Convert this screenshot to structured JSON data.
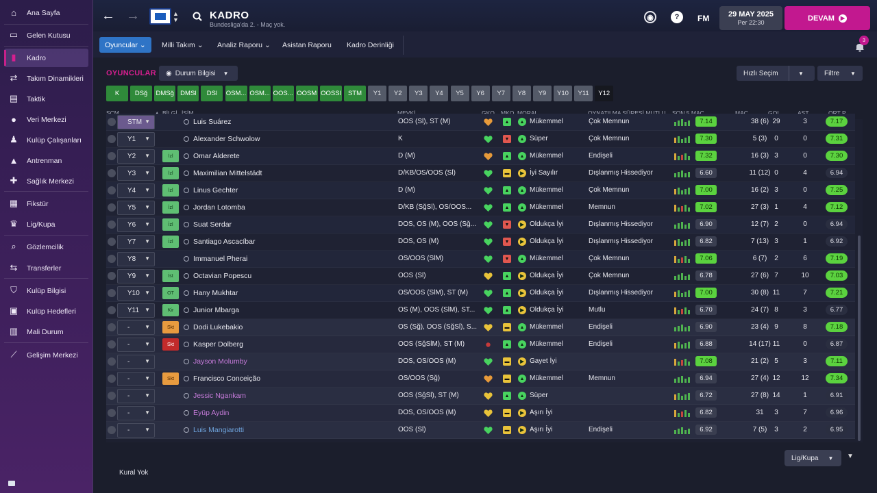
{
  "sidebar": [
    {
      "label": "Ana Sayfa",
      "icon": "home-icon",
      "glyph": "⌂"
    },
    {
      "label": "Gelen Kutusu",
      "icon": "inbox-icon",
      "glyph": "▭"
    },
    {
      "label": "Kadro",
      "icon": "shirt-icon",
      "glyph": "▮",
      "active": true
    },
    {
      "label": "Takım Dinamikleri",
      "icon": "team-dynamics-icon",
      "glyph": "⇄"
    },
    {
      "label": "Taktik",
      "icon": "tactics-icon",
      "glyph": "▤"
    },
    {
      "label": "Veri Merkezi",
      "icon": "data-hub-icon",
      "glyph": "●"
    },
    {
      "label": "Kulüp Çalışanları",
      "icon": "staff-icon",
      "glyph": "♟"
    },
    {
      "label": "Antrenman",
      "icon": "training-icon",
      "glyph": "▲"
    },
    {
      "label": "Sağlık Merkezi",
      "icon": "medical-icon",
      "glyph": "✚"
    },
    {
      "label": "Fikstür",
      "icon": "fixtures-icon",
      "glyph": "▦"
    },
    {
      "label": "Lig/Kupa",
      "icon": "trophy-icon",
      "glyph": "♛"
    },
    {
      "label": "Gözlemcilik",
      "icon": "scouting-icon",
      "glyph": "⌕"
    },
    {
      "label": "Transferler",
      "icon": "transfers-icon",
      "glyph": "⇆"
    },
    {
      "label": "Kulüp Bilgisi",
      "icon": "club-info-icon",
      "glyph": "⛉"
    },
    {
      "label": "Kulüp Hedefleri",
      "icon": "club-goals-icon",
      "glyph": "▣"
    },
    {
      "label": "Mali Durum",
      "icon": "finances-icon",
      "glyph": "▥"
    },
    {
      "label": "Gelişim Merkezi",
      "icon": "development-icon",
      "glyph": "⟋"
    }
  ],
  "header": {
    "title": "KADRO",
    "subtitle": "Bundesliga'da 2. - Maç yok.",
    "fm": "FM",
    "date": "29 MAY 2025",
    "time": "Per 22:30",
    "continue": "DEVAM",
    "notifications": "3"
  },
  "subnav": [
    "Oyuncular",
    "Milli Takım",
    "Analiz Raporu",
    "Asistan Raporu",
    "Kadro Derinliği"
  ],
  "toolbar": {
    "section": "OYUNCULAR",
    "view": "Durum Bilgisi",
    "quick": "Hızlı Seçim",
    "filter": "Filtre"
  },
  "positions": [
    "K",
    "DSğ",
    "DMSğ",
    "DMSl",
    "DSl",
    "OSM...",
    "OSM...",
    "OOS...",
    "OOSM",
    "OOSSl",
    "STM",
    "Y1",
    "Y2",
    "Y3",
    "Y4",
    "Y5",
    "Y6",
    "Y7",
    "Y8",
    "Y9",
    "Y10",
    "Y11",
    "Y12"
  ],
  "columns": {
    "sel": "SÇM",
    "info": "BİLGİ",
    "name": "İSİM",
    "position": "MEVKİ",
    "gko": "GKO",
    "mko": "MKO",
    "morale": "MORAL",
    "playing": "OYNATILMA SÜRESİ MUTLU...",
    "last5": "SON 5 MAÇ",
    "apps": "MAÇ",
    "goals": "GOL",
    "assists": "AST",
    "avg": "ORT P"
  },
  "players": [
    {
      "slot": "STM",
      "name": "Luis Suárez",
      "pos": "OOS (Sl), ST (M)",
      "gko": "orange",
      "mko": "green",
      "morale": "Mükemmel",
      "mi": "green",
      "sat": "Çok Memnun",
      "rating": "7.14",
      "rg": true,
      "apps": "38 (6)",
      "goals": "29",
      "ast": "3",
      "avg": "7.17",
      "ag": true
    },
    {
      "slot": "Y1",
      "name": "Alexander Schwolow",
      "pos": "K",
      "gko": "green",
      "mko": "red",
      "morale": "Süper",
      "mi": "green",
      "sat": "Çok Memnun",
      "rating": "7.30",
      "rg": true,
      "apps": "5 (3)",
      "goals": "0",
      "ast": "0",
      "avg": "7.31",
      "ag": true
    },
    {
      "slot": "Y2",
      "badge": "İzl",
      "name": "Omar Alderete",
      "pos": "D (M)",
      "gko": "orange",
      "mko": "green",
      "morale": "Mükemmel",
      "mi": "green",
      "sat": "Endişeli",
      "rating": "7.32",
      "rg": true,
      "apps": "16 (3)",
      "goals": "3",
      "ast": "0",
      "avg": "7.30",
      "ag": true
    },
    {
      "slot": "Y3",
      "badge": "İzl",
      "name": "Maximilian Mittelstädt",
      "pos": "D/KB/OS/OOS (Sl)",
      "gko": "green",
      "mko": "yellow",
      "morale": "İyi Sayılır",
      "mi": "yellow",
      "sat": "Dışlanmış Hissediyor",
      "rating": "6.60",
      "apps": "11 (12)",
      "goals": "0",
      "ast": "4",
      "avg": "6.94"
    },
    {
      "slot": "Y4",
      "badge": "İzl",
      "name": "Linus Gechter",
      "pos": "D (M)",
      "gko": "green",
      "mko": "green",
      "morale": "Mükemmel",
      "mi": "green",
      "sat": "Çok Memnun",
      "rating": "7.00",
      "rg": true,
      "apps": "16 (2)",
      "goals": "3",
      "ast": "0",
      "avg": "7.25",
      "ag": true
    },
    {
      "slot": "Y5",
      "badge": "İzl",
      "name": "Jordan Lotomba",
      "pos": "D/KB (SğSl), OS/OOS...",
      "gko": "green",
      "mko": "green",
      "morale": "Mükemmel",
      "mi": "green",
      "sat": "Memnun",
      "rating": "7.02",
      "rg": true,
      "apps": "27 (3)",
      "goals": "1",
      "ast": "4",
      "avg": "7.12",
      "ag": true
    },
    {
      "slot": "Y6",
      "badge": "İzl",
      "name": "Suat Serdar",
      "pos": "DOS, OS (M), OOS (Sğ...",
      "gko": "green",
      "mko": "red",
      "morale": "Oldukça İyi",
      "mi": "yellow",
      "sat": "Dışlanmış Hissediyor",
      "rating": "6.90",
      "apps": "12 (7)",
      "goals": "2",
      "ast": "0",
      "avg": "6.94"
    },
    {
      "slot": "Y7",
      "badge": "İzl",
      "name": "Santiago Ascacíbar",
      "pos": "DOS, OS (M)",
      "gko": "green",
      "mko": "red",
      "morale": "Oldukça İyi",
      "mi": "yellow",
      "sat": "Dışlanmış Hissediyor",
      "rating": "6.82",
      "apps": "7 (13)",
      "goals": "3",
      "ast": "1",
      "avg": "6.92"
    },
    {
      "slot": "Y8",
      "name": "Immanuel Pherai",
      "pos": "OS/OOS (SlM)",
      "gko": "green",
      "mko": "red",
      "morale": "Mükemmel",
      "mi": "green",
      "sat": "Çok Memnun",
      "rating": "7.06",
      "rg": true,
      "apps": "6 (7)",
      "goals": "2",
      "ast": "6",
      "avg": "7.19",
      "ag": true
    },
    {
      "slot": "Y9",
      "badge": "İst",
      "name": "Octavian Popescu",
      "pos": "OOS (Sl)",
      "gko": "yellow",
      "mko": "green",
      "morale": "Oldukça İyi",
      "mi": "yellow",
      "sat": "Çok Memnun",
      "rating": "6.78",
      "apps": "27 (6)",
      "goals": "7",
      "ast": "10",
      "avg": "7.03",
      "ag": true
    },
    {
      "slot": "Y10",
      "badge": "OT",
      "name": "Hany Mukhtar",
      "pos": "OS/OOS (SlM), ST (M)",
      "gko": "green",
      "mko": "green",
      "morale": "Oldukça İyi",
      "mi": "yellow",
      "sat": "Dışlanmış Hissediyor",
      "rating": "7.00",
      "rg": true,
      "apps": "30 (8)",
      "goals": "11",
      "ast": "7",
      "avg": "7.21",
      "ag": true
    },
    {
      "slot": "Y11",
      "badge": "Kir",
      "name": "Junior Mbarga",
      "pos": "OS (M), OOS (SlM), ST...",
      "gko": "green",
      "mko": "green",
      "morale": "Oldukça İyi",
      "mi": "yellow",
      "sat": "Mutlu",
      "rating": "6.70",
      "apps": "24 (7)",
      "goals": "8",
      "ast": "3",
      "avg": "6.77"
    },
    {
      "slot": "-",
      "badge": "Skt",
      "name": "Dodi Lukebakio",
      "pos": "OS (Sğ), OOS (SğSl), S...",
      "gko": "yellow",
      "mko": "yellow",
      "morale": "Mükemmel",
      "mi": "green",
      "sat": "Endişeli",
      "rating": "6.90",
      "apps": "23 (4)",
      "goals": "9",
      "ast": "8",
      "avg": "7.18",
      "ag": true,
      "res": true
    },
    {
      "slot": "-",
      "badge": "Skt",
      "bred": true,
      "name": "Kasper Dolberg",
      "pos": "OOS (SğSlM), ST (M)",
      "gko": "dot",
      "mko": "green",
      "morale": "Mükemmel",
      "mi": "green",
      "sat": "Endişeli",
      "rating": "6.88",
      "apps": "14 (17)",
      "goals": "11",
      "ast": "0",
      "avg": "6.87",
      "res": true
    },
    {
      "slot": "-",
      "name": "Jayson Molumby",
      "pos": "DOS, OS/OOS (M)",
      "gko": "green",
      "mko": "yellow",
      "morale": "Gayet İyi",
      "mi": "yellow",
      "sat": "",
      "rating": "7.08",
      "rg": true,
      "apps": "21 (2)",
      "goals": "5",
      "ast": "3",
      "avg": "7.11",
      "ag": true,
      "res": true,
      "loan": true
    },
    {
      "slot": "-",
      "badge": "Skt",
      "name": "Francisco Conceição",
      "pos": "OS/OOS (Sğ)",
      "gko": "orange",
      "mko": "yellow",
      "morale": "Mükemmel",
      "mi": "green",
      "sat": "Memnun",
      "rating": "6.94",
      "apps": "27 (4)",
      "goals": "12",
      "ast": "12",
      "avg": "7.34",
      "ag": true,
      "res": true
    },
    {
      "slot": "-",
      "name": "Jessic Ngankam",
      "pos": "OOS (SğSl), ST (M)",
      "gko": "yellow",
      "mko": "green",
      "morale": "Süper",
      "mi": "green",
      "sat": "",
      "rating": "6.72",
      "apps": "27 (8)",
      "goals": "14",
      "ast": "1",
      "avg": "6.91",
      "res": true,
      "loan": true
    },
    {
      "slot": "-",
      "name": "Eyüp Aydin",
      "pos": "DOS, OS/OOS (M)",
      "gko": "yellow",
      "mko": "yellow",
      "morale": "Aşırı İyi",
      "mi": "yellow",
      "sat": "",
      "rating": "6.82",
      "apps": "31",
      "goals": "3",
      "ast": "7",
      "avg": "6.96",
      "res": true,
      "loan": true
    },
    {
      "slot": "-",
      "name": "Luis Mangiarotti",
      "pos": "OOS (Sl)",
      "gko": "green",
      "mko": "yellow",
      "morale": "Aşırı İyi",
      "mi": "yellow",
      "sat": "Endişeli",
      "rating": "6.92",
      "apps": "7 (5)",
      "goals": "3",
      "ast": "2",
      "avg": "6.95",
      "res": true,
      "blue": true
    }
  ],
  "footer": {
    "competition": "Lig/Kupa",
    "rules": "Kural Yok"
  },
  "colors": {
    "accent": "#c2188f",
    "good": "#5bd23f",
    "tab": "#2f74c6",
    "chipGreen": "#2f8a3a",
    "chipGrey": "#545a68"
  }
}
